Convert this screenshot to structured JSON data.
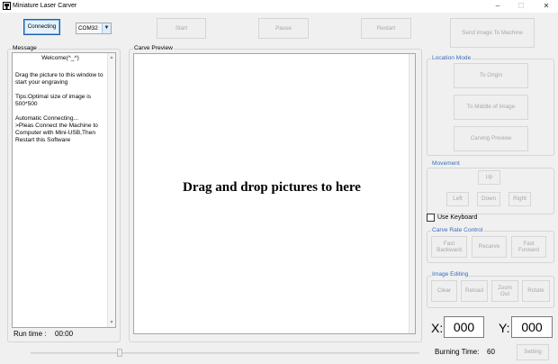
{
  "window": {
    "title": "Miniature Laser Carver",
    "minimize": "–",
    "maximize": "☐",
    "close": "✕"
  },
  "toolbar": {
    "connecting": "Connecting",
    "port": "COM32",
    "start": "Start",
    "pause": "Pause",
    "restart": "Restart",
    "send_image": "Send image To Machine"
  },
  "message": {
    "label": "Message",
    "welcome": "Welcome(^_^)",
    "body": "Drag the picture to this window to start your engraving\n\nTips:Optimal size of image is 500*500\n\nAutomatic Connecting...\n>Pleas Connect the Machine to Computer with Mini-USB,Then Restart this Software",
    "run_time_label": "Run time :",
    "run_time": "00:00"
  },
  "carve_preview": {
    "label": "Carve Preview",
    "placeholder": "Drag and drop pictures to here"
  },
  "location_mode": {
    "label": "Location Mode",
    "to_origin": "To Origin",
    "to_middle": "To Middle of Image",
    "carving_preview": "Carving Preview"
  },
  "movement": {
    "label": "Movement",
    "up": "Up",
    "left": "Left",
    "down": "Down",
    "right": "Right",
    "use_keyboard": "Use Keyboard"
  },
  "carve_rate": {
    "label": "Carve Rate Control",
    "fast_backward": "Fast Backward",
    "recarve": "Recarve",
    "fast_forward": "Fast Forward"
  },
  "image_editing": {
    "label": "Image Editing",
    "clear": "Clear",
    "reload": "Reload",
    "zoom_out": "Zoom Out",
    "rotate": "Rotate"
  },
  "coords": {
    "x_label": "X:",
    "x": "000",
    "y_label": "Y:",
    "y": "000"
  },
  "burning": {
    "label": "Burning Time:",
    "value": "60",
    "setting": "Setting",
    "slider_level": 0.23
  }
}
